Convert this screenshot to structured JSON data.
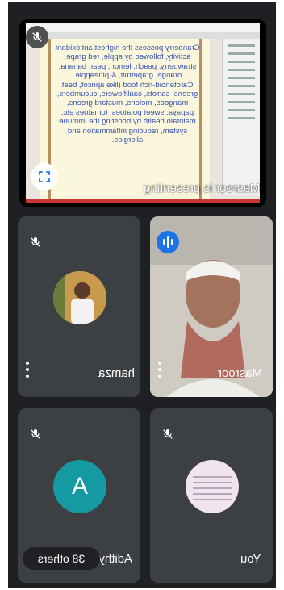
{
  "presentation": {
    "slide_text": "Cranberry possess the highest antioxidant activity, followed by apple, red grape, strawberry, peach, lemon, pear, banana, orange, grapefruit, & pineapple. Carotenoid-rich food (like apricot, beet greens, carrots, cauliflowers, cucumbers, mangoes, melons, mustard greens, papaya, sweet potatoes, tomatoes etc. maintain health by boosting the immune system, reducing inflammation and allergies.",
    "label": "Masroor is presenting",
    "muted_icon": "mic-off-icon",
    "expand_icon": "fullscreen-icon"
  },
  "participants": {
    "hamza": {
      "name": "hamza",
      "muted_icon": "mic-off-icon",
      "more_icon": "more-vert-icon"
    },
    "masroor": {
      "name": "Masroor",
      "speaking_icon": "audio-level-icon",
      "more_icon": "more-vert-icon"
    },
    "adithya": {
      "name": "Adithya",
      "initial": "A",
      "muted_icon": "mic-off-icon"
    },
    "you": {
      "name": "You",
      "muted_icon": "mic-off-icon"
    }
  },
  "others_chip": {
    "label": "38 others"
  },
  "colors": {
    "background": "#1f2023",
    "tile": "#3c4043",
    "accent": "#1a73e8",
    "avatar_a": "#159aa2"
  }
}
